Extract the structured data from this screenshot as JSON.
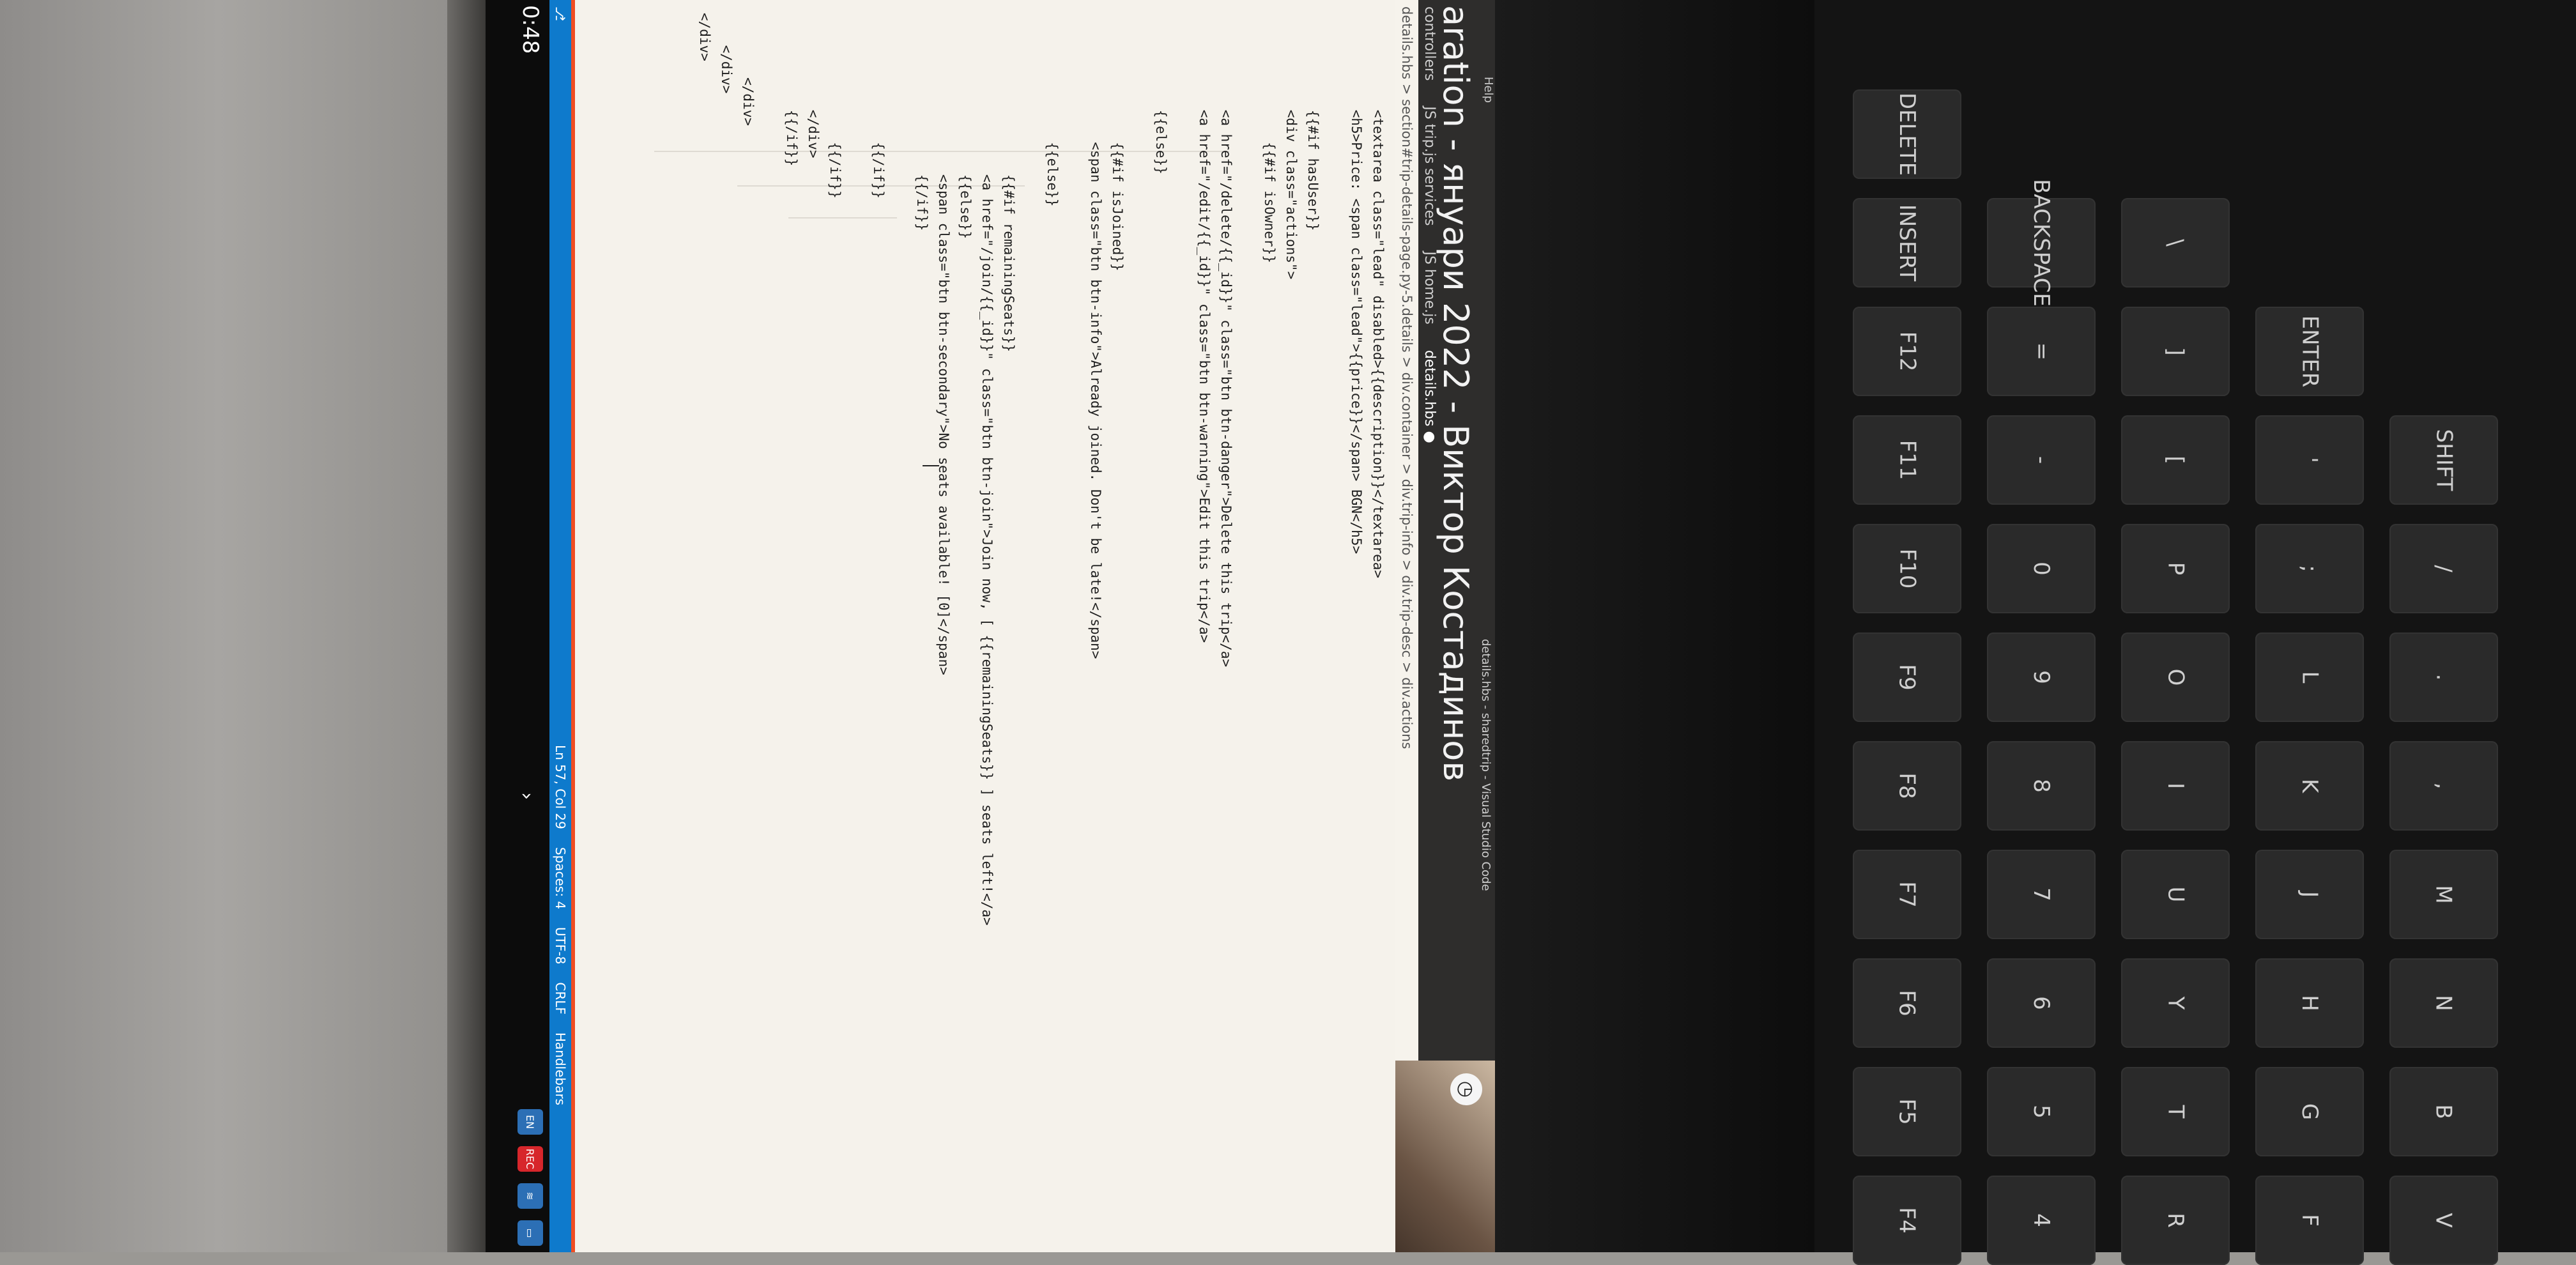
{
  "window": {
    "menu_items": [
      "Help"
    ],
    "title": "details.hbs - sharedtrip - Visual Studio Code",
    "heading": "aration - януари 2022 - Виктор Костадинов"
  },
  "tabs": [
    {
      "label": "controllers"
    },
    {
      "label": "JS trip.js  services"
    },
    {
      "label": "JS home.js"
    },
    {
      "label": "details.hbs ●",
      "active": true
    }
  ],
  "breadcrumb": "details.hbs > section#trip-details-page.py-5.details > div.container > div.trip-info > div.trip-desc > div.actions",
  "code_lines": [
    "            <textarea class=\"lead\" disabled>{{description}}</textarea>",
    "            <h5>Price: <span class=\"lead\">{{price}}</span> BGN</h5>",
    "",
    "            {{#if hasUser}}",
    "            <div class=\"actions\">",
    "                {{#if isOwner}}",
    "",
    "            <a href=\"/delete/{{_id}}\" class=\"btn btn-danger\">Delete this trip</a>",
    "            <a href=\"/edit/{{_id}}\" class=\"btn btn-warning\">Edit this trip</a>",
    "",
    "            {{else}}",
    "",
    "                {{#if isJoined}}",
    "                <span class=\"btn btn-info\">Already joined. Don't be late!</span>",
    "",
    "                {{else}}",
    "",
    "                    {{#if remainingSeats}}",
    "                    <a href=\"/join/{{_id}}\" class=\"btn btn-join\">Join now, [ {{remainingSeats}} ] seats left!</a>",
    "                    {{else}}",
    "                    <span class=\"btn btn-secondary\">No seats available! [0]</span>",
    "                    {{/if}}",
    "",
    "                {{/if}}",
    "",
    "                {{/if}}",
    "            </div>",
    "            {{/if}}",
    "",
    "        </div>",
    "    </div>",
    "</div>"
  ],
  "status": {
    "position": "Ln 57, Col 29",
    "spaces": "Spaces: 4",
    "encoding": "UTF-8",
    "eol": "CRLF",
    "language": "Handlebars",
    "color": "#0e7acc"
  },
  "taskbar": {
    "time": "0:48",
    "tray": [
      "EN",
      "REC",
      "wifi-icon",
      "notifications-icon"
    ]
  },
  "keyboard_rows": [
    [
      "F4",
      "F5",
      "F6",
      "F7",
      "F8",
      "F9",
      "F10",
      "F11",
      "F12",
      "INSERT",
      "DELETE"
    ],
    [
      "4",
      "5",
      "6",
      "7",
      "8",
      "9",
      "0",
      "-",
      "=",
      "BACKSPACE"
    ],
    [
      "R",
      "T",
      "Y",
      "U",
      "I",
      "O",
      "P",
      "[",
      "]",
      "\\"
    ],
    [
      "F",
      "G",
      "H",
      "J",
      "K",
      "L",
      ";",
      "'",
      "ENTER"
    ],
    [
      "V",
      "B",
      "N",
      "M",
      ",",
      ".",
      "/",
      "SHIFT"
    ]
  ]
}
